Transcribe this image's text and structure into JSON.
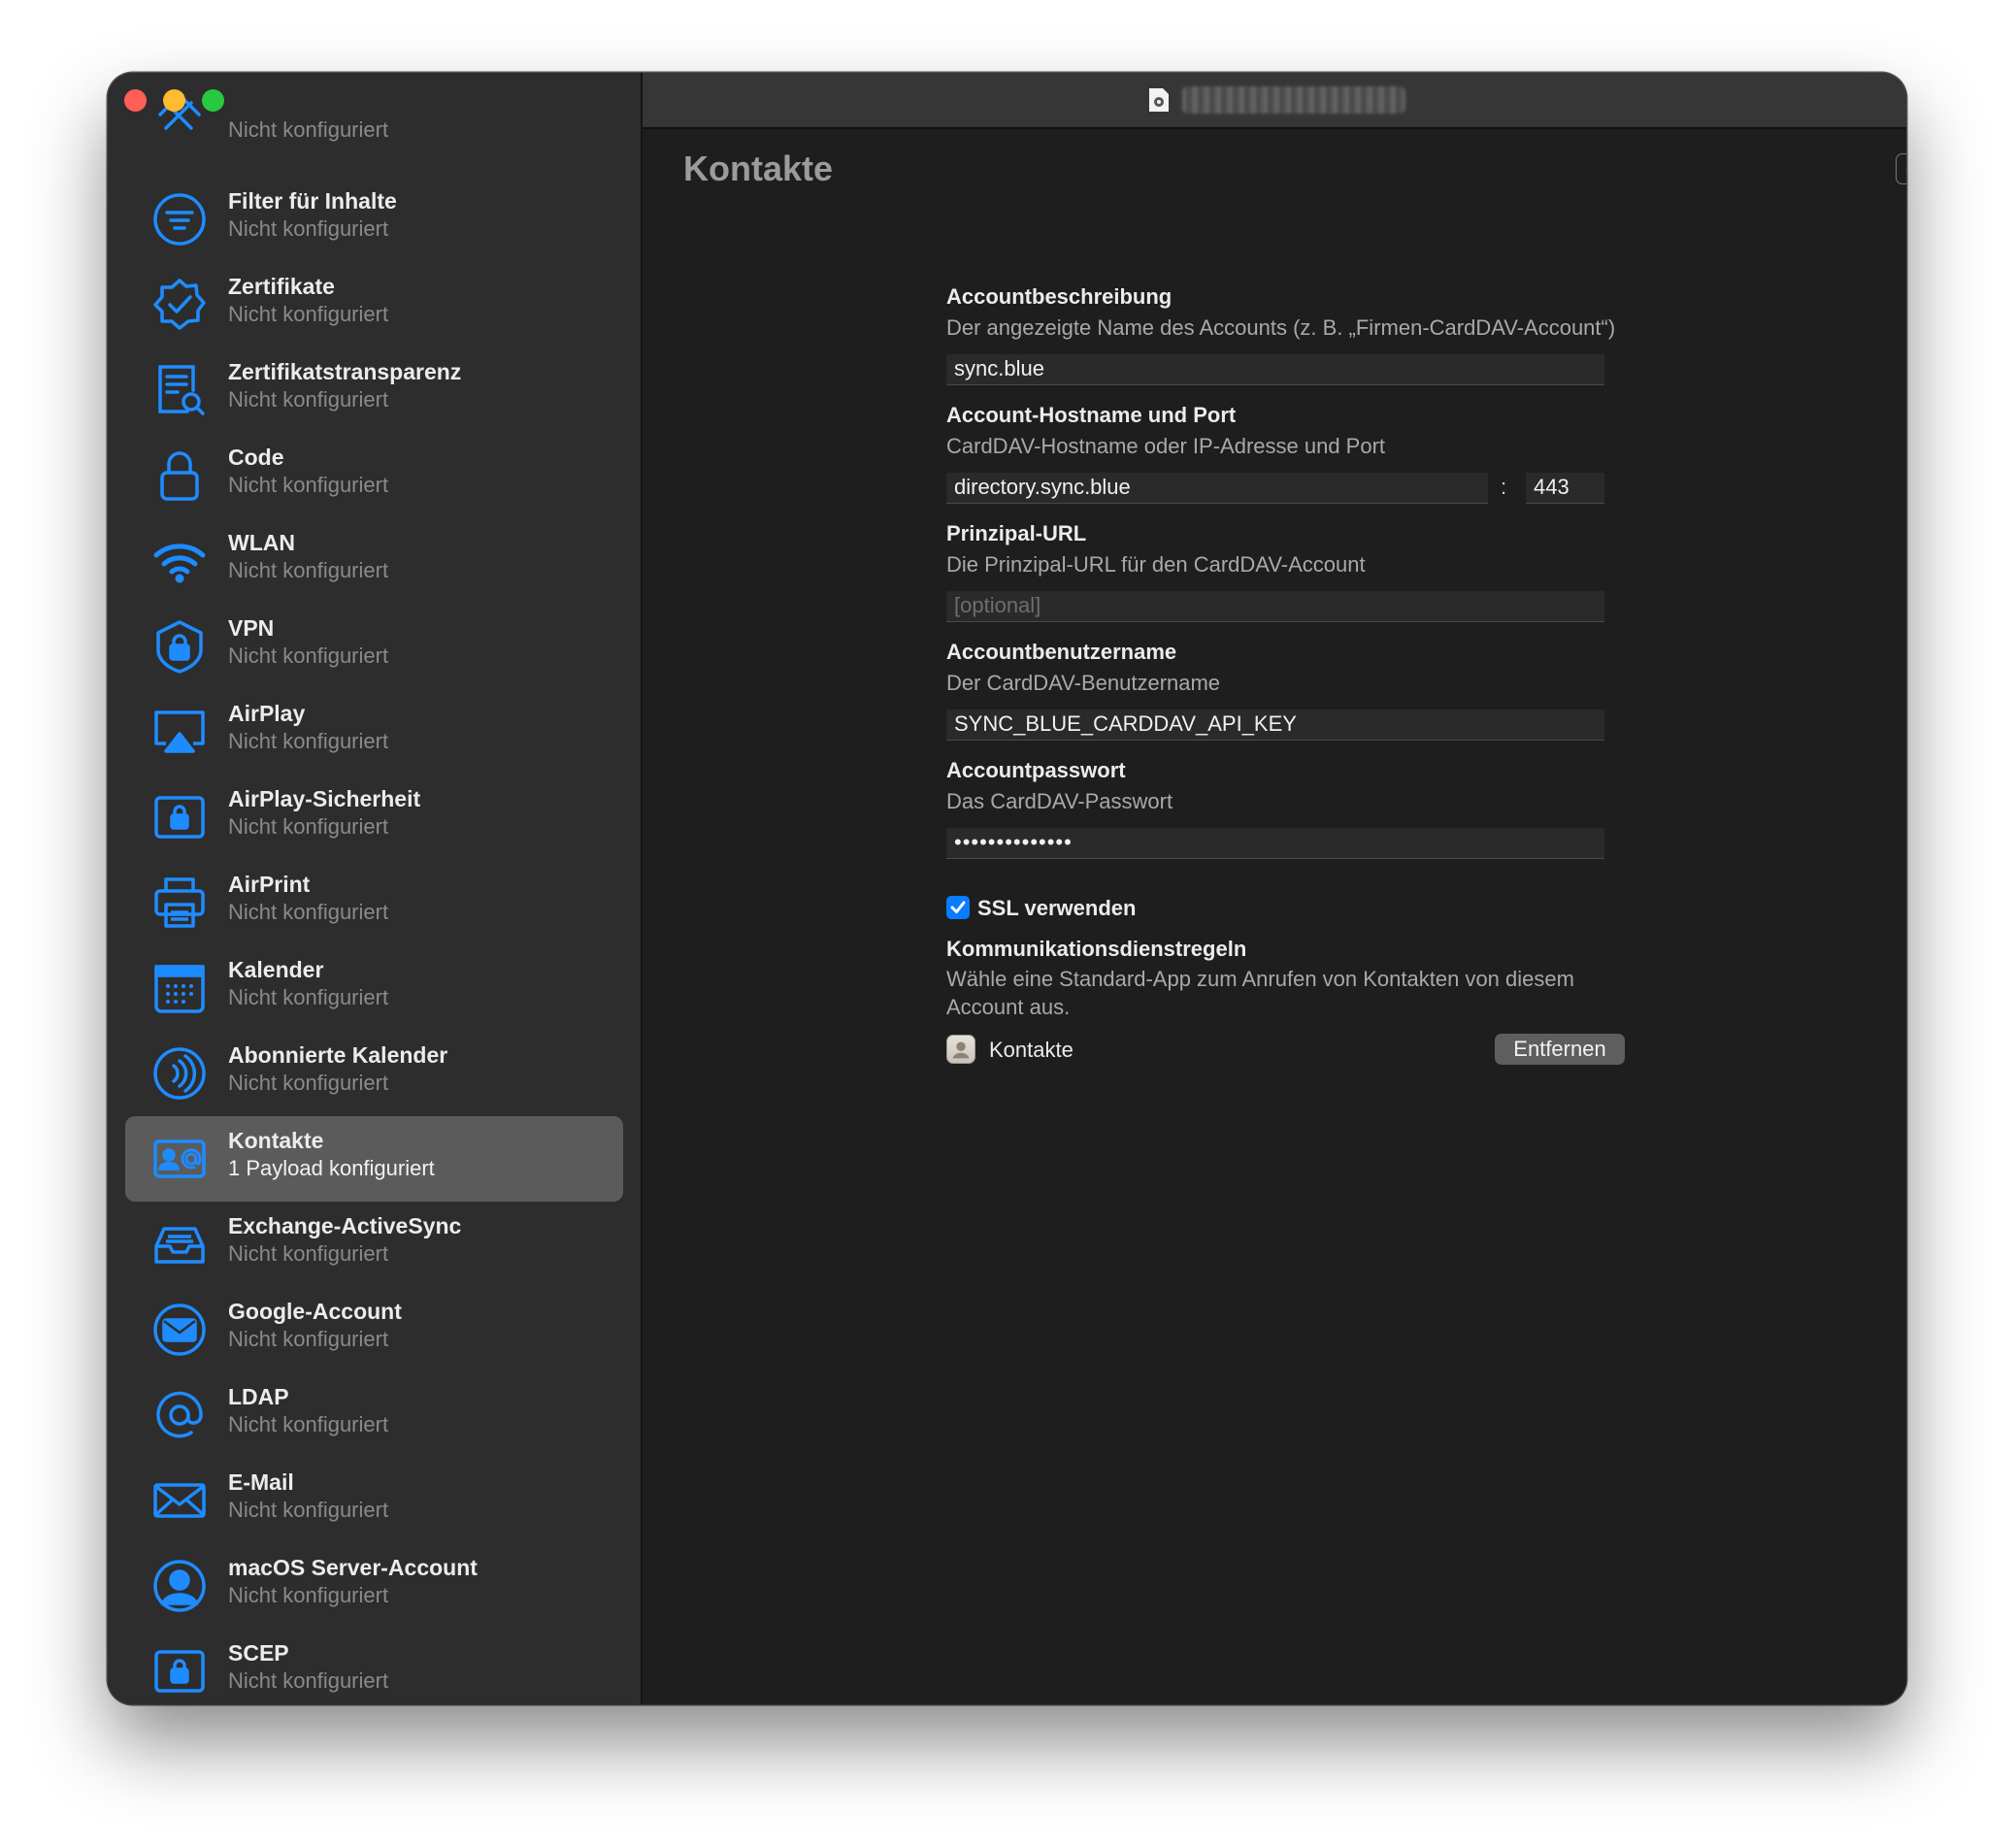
{
  "window": {
    "title": "Kontakte",
    "controls": {
      "minus_label": "–",
      "plus_label": "+"
    }
  },
  "sidebar": {
    "items": [
      {
        "title": "",
        "status": "Nicht konfiguriert",
        "icon": "tools-icon"
      },
      {
        "title": "Filter für Inhalte",
        "status": "Nicht konfiguriert",
        "icon": "filter-icon"
      },
      {
        "title": "Zertifikate",
        "status": "Nicht konfiguriert",
        "icon": "certificate-badge-icon"
      },
      {
        "title": "Zertifikatstransparenz",
        "status": "Nicht konfiguriert",
        "icon": "document-search-icon"
      },
      {
        "title": "Code",
        "status": "Nicht konfiguriert",
        "icon": "lock-icon"
      },
      {
        "title": "WLAN",
        "status": "Nicht konfiguriert",
        "icon": "wifi-icon"
      },
      {
        "title": "VPN",
        "status": "Nicht konfiguriert",
        "icon": "shield-lock-icon"
      },
      {
        "title": "AirPlay",
        "status": "Nicht konfiguriert",
        "icon": "airplay-icon"
      },
      {
        "title": "AirPlay-Sicherheit",
        "status": "Nicht konfiguriert",
        "icon": "airplay-lock-icon"
      },
      {
        "title": "AirPrint",
        "status": "Nicht konfiguriert",
        "icon": "printer-icon"
      },
      {
        "title": "Kalender",
        "status": "Nicht konfiguriert",
        "icon": "calendar-icon"
      },
      {
        "title": "Abonnierte Kalender",
        "status": "Nicht konfiguriert",
        "icon": "subscribed-calendar-icon"
      },
      {
        "title": "Kontakte",
        "status": "1 Payload konfiguriert",
        "icon": "contact-card-icon"
      },
      {
        "title": "Exchange-ActiveSync",
        "status": "Nicht konfiguriert",
        "icon": "inbox-tray-icon"
      },
      {
        "title": "Google-Account",
        "status": "Nicht konfiguriert",
        "icon": "envelope-circle-icon"
      },
      {
        "title": "LDAP",
        "status": "Nicht konfiguriert",
        "icon": "at-sign-icon"
      },
      {
        "title": "E-Mail",
        "status": "Nicht konfiguriert",
        "icon": "envelope-icon"
      },
      {
        "title": "macOS Server-Account",
        "status": "Nicht konfiguriert",
        "icon": "person-circle-icon"
      },
      {
        "title": "SCEP",
        "status": "Nicht konfiguriert",
        "icon": "lock-box-icon"
      }
    ],
    "selected_index": 12
  },
  "form": {
    "description": {
      "label": "Accountbeschreibung",
      "help": "Der angezeigte Name des Accounts (z. B. „Firmen-CardDAV-Account“)",
      "value": "sync.blue"
    },
    "host": {
      "label": "Account-Hostname und Port",
      "help": "CardDAV-Hostname oder IP-Adresse und Port",
      "value": "directory.sync.blue",
      "separator": ":",
      "port": "443"
    },
    "principal_url": {
      "label": "Prinzipal-URL",
      "help": "Die Prinzipal-URL für den CardDAV-Account",
      "placeholder": "[optional]"
    },
    "username": {
      "label": "Accountbenutzername",
      "help": "Der CardDAV-Benutzername",
      "value": "SYNC_BLUE_CARDDAV_API_KEY"
    },
    "password": {
      "label": "Accountpasswort",
      "help": "Das CardDAV-Passwort",
      "value": "••••••••••••••"
    },
    "ssl": {
      "label": "SSL verwenden",
      "checked": true
    },
    "communication": {
      "label": "Kommunikationsdienstregeln",
      "help_line1": "Wähle eine Standard-App zum Anrufen von Kontakten von diesem",
      "help_line2": "Account aus.",
      "app_name": "Kontakte",
      "remove_label": "Entfernen"
    }
  },
  "colors": {
    "accent": "#0a7cff",
    "icon_blue": "#1e8cff",
    "sidebar_bg": "#2d2d2e",
    "main_bg": "#1e1e1e",
    "selected_bg": "#5b5b5c"
  }
}
